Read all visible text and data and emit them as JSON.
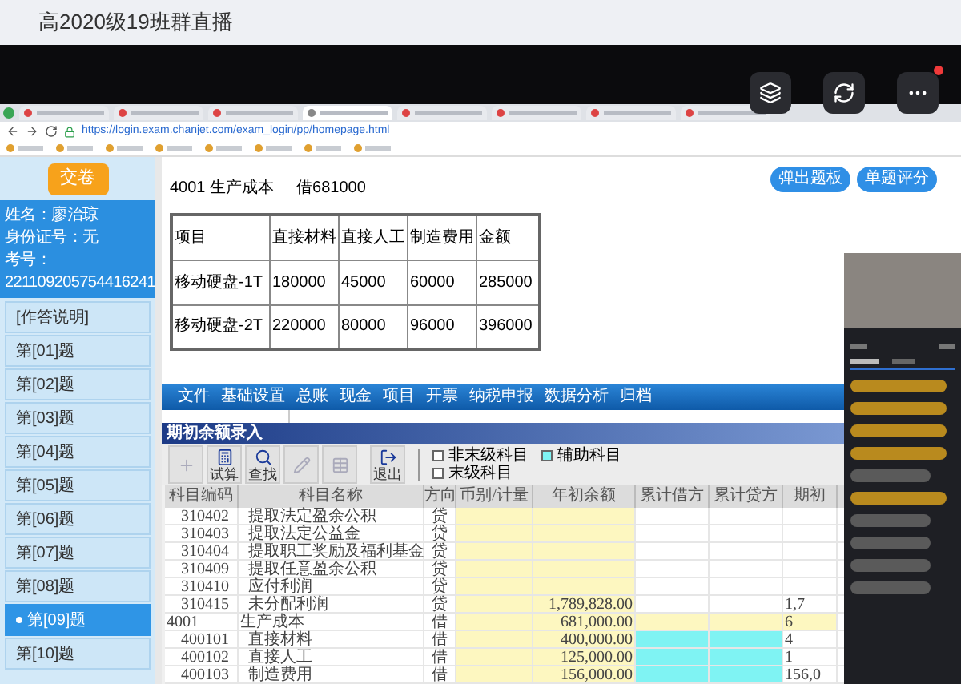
{
  "window": {
    "title": "高2020级19班群直播"
  },
  "live_controls": [
    {
      "kind": "layers",
      "badge": false
    },
    {
      "kind": "rotate",
      "badge": false
    },
    {
      "kind": "more",
      "badge": true
    }
  ],
  "browser": {
    "tabs": [
      {
        "selected": false
      },
      {
        "selected": false
      },
      {
        "selected": false
      },
      {
        "selected": true
      },
      {
        "selected": false
      },
      {
        "selected": false
      },
      {
        "selected": false
      },
      {
        "selected": false
      }
    ],
    "url": "https://login.exam.chanjet.com/exam_login/pp/homepage.html"
  },
  "exam_sidebar": {
    "submit_button": "交卷",
    "candidate": [
      "姓名：廖治琼",
      "身份证号：无",
      "考号：",
      "221109205754416241"
    ],
    "questions": [
      {
        "label": "[作答说明]",
        "selected": false
      },
      {
        "label": "第[01]题",
        "selected": false
      },
      {
        "label": "第[02]题",
        "selected": false
      },
      {
        "label": "第[03]题",
        "selected": false
      },
      {
        "label": "第[04]题",
        "selected": false
      },
      {
        "label": "第[05]题",
        "selected": false
      },
      {
        "label": "第[06]题",
        "selected": false
      },
      {
        "label": "第[07]题",
        "selected": false
      },
      {
        "label": "第[08]题",
        "selected": false
      },
      {
        "label": "第[09]题",
        "selected": true
      },
      {
        "label": "第[10]题",
        "selected": false
      }
    ]
  },
  "top_buttons": [
    "弹出题板",
    "单题评分"
  ],
  "question": {
    "account": "4001 生产成本",
    "balance": "借681000",
    "columns": [
      "项目",
      "直接材料",
      "直接人工",
      "制造费用",
      "金额"
    ],
    "rows": [
      [
        "移动硬盘-1T",
        "180000",
        "45000",
        "60000",
        "285000"
      ],
      [
        "移动硬盘-2T",
        "220000",
        "80000",
        "96000",
        "396000"
      ]
    ]
  },
  "software": {
    "menu": [
      "文件",
      "基础设置",
      "总账",
      "现金",
      "项目",
      "开票",
      "纳税申报",
      "数据分析",
      "归档"
    ],
    "window_title": "期初余额录入",
    "toolbar": [
      {
        "kind": "add",
        "disabled": true
      },
      {
        "kind": "trial",
        "label": "试算",
        "disabled": false
      },
      {
        "kind": "find",
        "label": "查找",
        "disabled": false
      },
      {
        "kind": "edit",
        "disabled": true
      },
      {
        "kind": "grid",
        "disabled": true
      },
      {
        "kind": "exit",
        "label": "退出",
        "disabled": false
      }
    ],
    "legend": [
      {
        "label": "非末级科目",
        "color": "#ffffff"
      },
      {
        "label": "辅助科目",
        "color": "#7ff3f3"
      },
      {
        "label": "末级科目",
        "color": "#ffffff"
      }
    ],
    "columns": [
      "科目编码",
      "科目名称",
      "方向",
      "币别/计量",
      "年初余额",
      "累计借方",
      "累计贷方",
      "期初"
    ],
    "rows": [
      {
        "kind": "leaf",
        "code": "310402",
        "name": "提取法定盈余公积",
        "direction": "贷"
      },
      {
        "kind": "leaf",
        "code": "310403",
        "name": "提取法定公益金",
        "direction": "贷"
      },
      {
        "kind": "leaf",
        "code": "310404",
        "name": "提取职工奖励及福利基金",
        "direction": "贷"
      },
      {
        "kind": "leaf",
        "code": "310409",
        "name": "提取任意盈余公积",
        "direction": "贷"
      },
      {
        "kind": "leaf",
        "code": "310410",
        "name": "应付利润",
        "direction": "贷"
      },
      {
        "kind": "leaf",
        "code": "310415",
        "name": "未分配利润",
        "direction": "贷",
        "opening": "1,789,828.00",
        "end": "1,7"
      },
      {
        "kind": "parent",
        "code": "4001",
        "name": "生产成本",
        "direction": "借",
        "opening": "681,000.00",
        "end": "6"
      },
      {
        "kind": "auxiliary",
        "code": "400101",
        "name": "直接材料",
        "direction": "借",
        "opening": "400,000.00",
        "end": "4"
      },
      {
        "kind": "auxiliary",
        "code": "400102",
        "name": "直接人工",
        "direction": "借",
        "opening": "125,000.00",
        "end": "1"
      },
      {
        "kind": "auxiliary",
        "code": "400103",
        "name": "制造费用",
        "direction": "借",
        "opening": "156,000.00",
        "end": "156,0"
      }
    ]
  }
}
